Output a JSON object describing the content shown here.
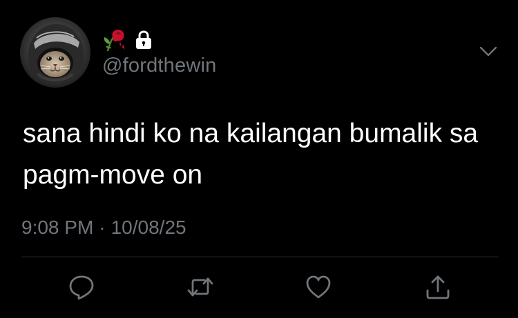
{
  "user": {
    "handle": "@fordthewin",
    "avatar_icon": "motorcycle-helmet-cat-avatar",
    "badges": [
      "wilted-rose-icon",
      "lock-icon"
    ]
  },
  "tweet": {
    "text": "sana hindi ko na kailangan bumalik sa pagm-move on",
    "time": "9:08 PM",
    "separator": "·",
    "date": "10/08/25"
  },
  "actions": {
    "icons": [
      "reply-icon",
      "retweet-icon",
      "like-icon",
      "share-icon"
    ]
  },
  "colors": {
    "background": "#000000",
    "text": "#ffffff",
    "muted": "#71767b",
    "divider": "#2f3336",
    "rose": "#c8102e"
  }
}
